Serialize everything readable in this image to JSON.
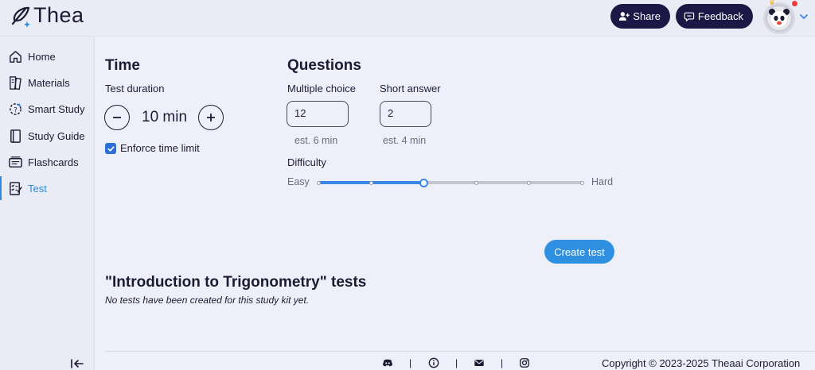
{
  "header": {
    "logo_text": "Thea",
    "share_label": "Share",
    "feedback_label": "Feedback"
  },
  "sidebar": {
    "items": [
      {
        "label": "Home",
        "icon": "home-icon"
      },
      {
        "label": "Materials",
        "icon": "materials-icon"
      },
      {
        "label": "Smart Study",
        "icon": "smart-study-icon"
      },
      {
        "label": "Study Guide",
        "icon": "study-guide-icon"
      },
      {
        "label": "Flashcards",
        "icon": "flashcards-icon"
      },
      {
        "label": "Test",
        "icon": "test-icon",
        "active": true
      }
    ]
  },
  "time": {
    "title": "Time",
    "duration_label": "Test duration",
    "duration_value": "10 min",
    "enforce_label": "Enforce time limit",
    "enforce_checked": true
  },
  "questions": {
    "title": "Questions",
    "multiple_choice_label": "Multiple choice",
    "multiple_choice_value": "12",
    "multiple_choice_est": "est. 6 min",
    "short_answer_label": "Short answer",
    "short_answer_value": "2",
    "short_answer_est": "est. 4 min",
    "difficulty_label": "Difficulty",
    "difficulty_min_label": "Easy",
    "difficulty_max_label": "Hard",
    "difficulty_steps": 6,
    "difficulty_value": 3
  },
  "create_button_label": "Create test",
  "tests": {
    "title": "\"Introduction to Trigonometry\" tests",
    "empty_message": "No tests have been created for this study kit yet."
  },
  "footer": {
    "icons": [
      "discord-icon",
      "info-icon",
      "mail-icon",
      "instagram-icon"
    ],
    "separator": "|",
    "copyright": "Copyright © 2023-2025 Theaai Corporation"
  },
  "colors": {
    "accent": "#2f8fe0",
    "dark": "#1b1845",
    "background": "#eef0f9"
  }
}
